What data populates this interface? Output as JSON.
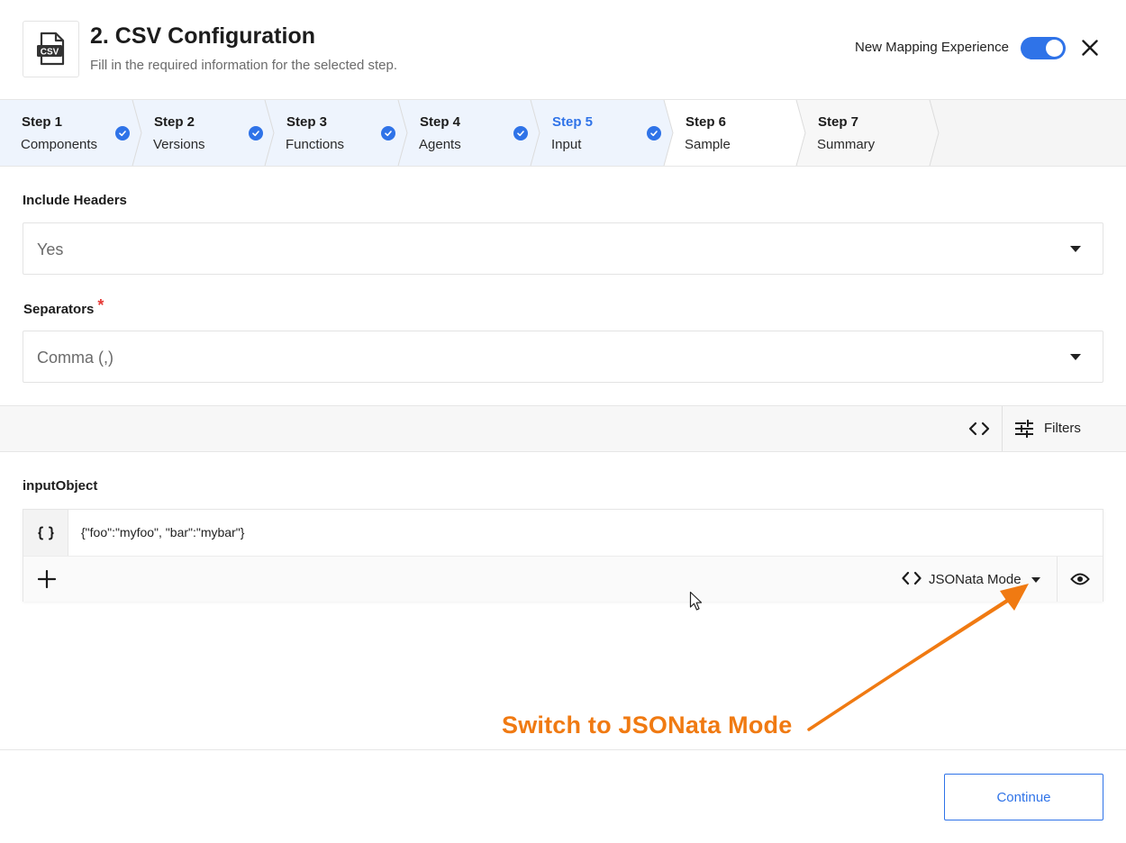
{
  "header": {
    "title": "2. CSV Configuration",
    "subtitle": "Fill in the required information for the selected step.",
    "icon_text": "CSV",
    "new_mapping_label": "New Mapping Experience",
    "new_mapping_enabled": true
  },
  "stepper": {
    "steps": [
      {
        "number": "Step 1",
        "name": "Components",
        "completed": true
      },
      {
        "number": "Step 2",
        "name": "Versions",
        "completed": true
      },
      {
        "number": "Step 3",
        "name": "Functions",
        "completed": true
      },
      {
        "number": "Step 4",
        "name": "Agents",
        "completed": true
      },
      {
        "number": "Step 5",
        "name": "Input",
        "completed": true,
        "active": true
      },
      {
        "number": "Step 6",
        "name": "Sample",
        "completed": false
      },
      {
        "number": "Step 7",
        "name": "Summary",
        "completed": false
      }
    ]
  },
  "form": {
    "include_headers": {
      "label": "Include Headers",
      "value": "Yes"
    },
    "separators": {
      "label": "Separators",
      "required_mark": "*",
      "value": "Comma (,)"
    }
  },
  "toolbar": {
    "filters_label": "Filters"
  },
  "input_object": {
    "label": "inputObject",
    "value": "{\"foo\":\"myfoo\", \"bar\":\"mybar\"}",
    "mode_label": "JSONata Mode"
  },
  "annotation": {
    "text": "Switch to JSONata Mode"
  },
  "footer": {
    "continue_label": "Continue"
  },
  "colors": {
    "accent": "#2f73e8",
    "annotation": "#f07a12",
    "required": "#e53935"
  }
}
